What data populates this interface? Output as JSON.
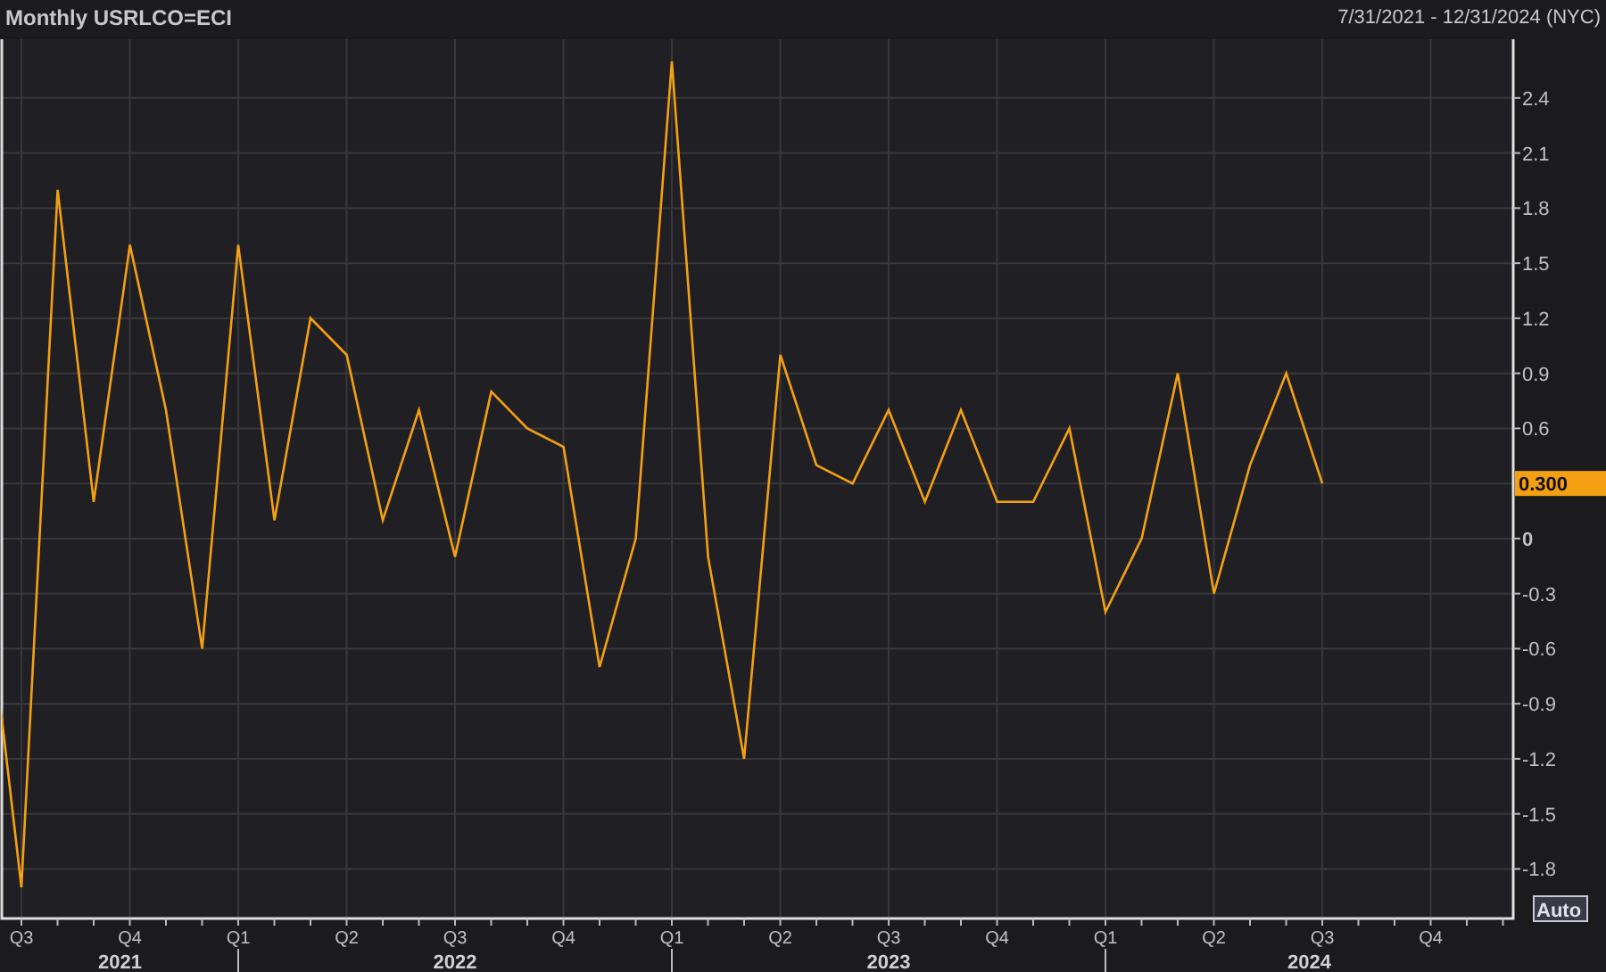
{
  "header": {
    "title": "Monthly USRLCO=ECI",
    "date_range": "7/31/2021 - 12/31/2024 (NYC)"
  },
  "chart": {
    "last_value_label": "0.300",
    "auto_button": "Auto",
    "year_labels": [
      "2021",
      "2022",
      "2023",
      "2024"
    ],
    "chart_data": {
      "type": "line",
      "grid": true,
      "categories": [
        null,
        "Q3",
        null,
        null,
        "Q4",
        null,
        null,
        "Q1",
        null,
        null,
        "Q2",
        null,
        null,
        "Q3",
        null,
        null,
        "Q4",
        null,
        null,
        "Q1",
        null,
        null,
        "Q2",
        null,
        null,
        "Q3",
        null,
        null,
        "Q4",
        null,
        null,
        "Q1",
        null,
        null,
        "Q2",
        null,
        null,
        "Q3",
        null,
        null,
        "Q4",
        null
      ],
      "series": [
        {
          "color": "#f5a012",
          "values": [
            -0.2,
            -1.9,
            1.9,
            0.2,
            1.6,
            0.7,
            -0.6,
            1.6,
            0.1,
            1.2,
            1.0,
            0.1,
            0.7,
            -0.1,
            0.8,
            0.6,
            0.5,
            -0.7,
            0.0,
            2.6,
            -0.1,
            -1.2,
            1.0,
            0.4,
            0.3,
            0.7,
            0.2,
            0.7,
            0.2,
            0.2,
            0.6,
            -0.4,
            0.0,
            0.9,
            -0.3,
            0.4,
            0.9,
            0.3,
            null,
            null,
            null,
            null
          ]
        }
      ],
      "ylim": [
        -2.07,
        2.72
      ],
      "yticks": [
        {
          "value": -1.8,
          "label": "-1.8"
        },
        {
          "value": -1.5,
          "label": "-1.5"
        },
        {
          "value": -1.2,
          "label": "-1.2"
        },
        {
          "value": -0.9,
          "label": "-0.9"
        },
        {
          "value": -0.6,
          "label": "-0.6"
        },
        {
          "value": -0.3,
          "label": "-0.3"
        },
        {
          "value": 0,
          "label": "0"
        },
        {
          "value": 0.6,
          "label": "0.6"
        },
        {
          "value": 0.9,
          "label": "0.9"
        },
        {
          "value": 1.2,
          "label": "1.2"
        },
        {
          "value": 1.5,
          "label": "1.5"
        },
        {
          "value": 1.8,
          "label": "1.8"
        },
        {
          "value": 2.1,
          "label": "2.1"
        },
        {
          "value": 2.4,
          "label": "2.4"
        }
      ]
    }
  }
}
